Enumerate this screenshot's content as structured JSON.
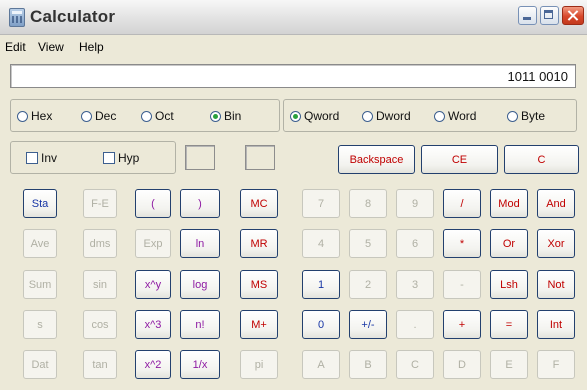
{
  "window": {
    "title": "Calculator"
  },
  "menu": {
    "edit": "Edit",
    "view": "View",
    "help": "Help"
  },
  "display": {
    "value": "1011 0010"
  },
  "base": {
    "options": [
      {
        "label": "Hex",
        "selected": false
      },
      {
        "label": "Dec",
        "selected": false
      },
      {
        "label": "Oct",
        "selected": false
      },
      {
        "label": "Bin",
        "selected": true
      }
    ]
  },
  "word_size": {
    "options": [
      {
        "label": "Qword",
        "selected": true
      },
      {
        "label": "Dword",
        "selected": false
      },
      {
        "label": "Word",
        "selected": false
      },
      {
        "label": "Byte",
        "selected": false
      }
    ]
  },
  "modifiers": {
    "inv": "Inv",
    "hyp": "Hyp"
  },
  "colors": {
    "blue": "#1836a5",
    "red": "#c00000",
    "purple": "#8e1aa3",
    "disabled": "#b0b0a4"
  },
  "keys": {
    "backspace": "Backspace",
    "ce": "CE",
    "c": "C",
    "sta": "Sta",
    "fe": "F-E",
    "lparen": "(",
    "rparen": ")",
    "mc": "MC",
    "n7": "7",
    "n8": "8",
    "n9": "9",
    "div": "/",
    "mod": "Mod",
    "and": "And",
    "ave": "Ave",
    "dms": "dms",
    "exp": "Exp",
    "ln": "ln",
    "mr": "MR",
    "n4": "4",
    "n5": "5",
    "n6": "6",
    "mul": "*",
    "or": "Or",
    "xor": "Xor",
    "sum": "Sum",
    "sin": "sin",
    "xy": "x^y",
    "log": "log",
    "ms": "MS",
    "n1": "1",
    "n2": "2",
    "n3": "3",
    "sub": "-",
    "lsh": "Lsh",
    "not": "Not",
    "s": "s",
    "cos": "cos",
    "x3": "x^3",
    "nfact": "n!",
    "mplus": "M+",
    "n0": "0",
    "sign": "+/-",
    "dot": ".",
    "add": "+",
    "eq": "=",
    "int": "Int",
    "dat": "Dat",
    "tan": "tan",
    "x2": "x^2",
    "inv": "1/x",
    "pi": "pi",
    "a": "A",
    "b": "B",
    "c_hex": "C",
    "d": "D",
    "e": "E",
    "f": "F"
  }
}
